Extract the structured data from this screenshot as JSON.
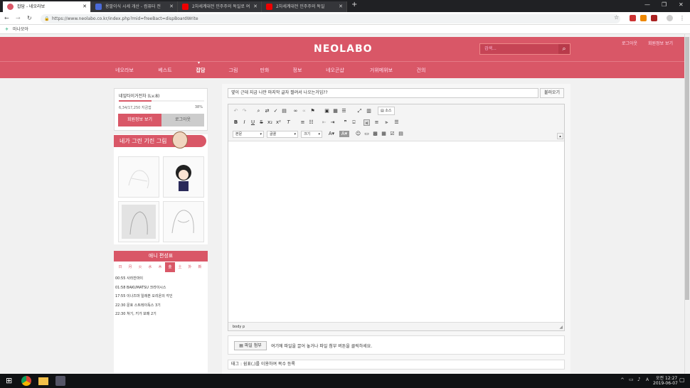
{
  "browser": {
    "tabs": [
      {
        "title": "잡담 - 네오라보"
      },
      {
        "title": "용팔이식 시세 개산 - 컴퓨터 전"
      },
      {
        "title": "2차세계대전 민주주의 독일로 여"
      },
      {
        "title": "2차세계대전 민주주의 독일"
      }
    ],
    "new_tab": "+",
    "url": "https://www.neolabo.co.kr/index.php?mid=freeBact=dispBoardWrite",
    "bookmark": "마나모아"
  },
  "site": {
    "logo": "NEOLABO",
    "search_placeholder": "검색...",
    "top_links": [
      "로그아웃",
      "회원정보 보기"
    ],
    "nav": [
      "네오라보",
      "베스트",
      "잡담",
      "그림",
      "만화",
      "정보",
      "네오곤샵",
      "거위메위보",
      "건의"
    ],
    "active_nav": "잡담"
  },
  "profile": {
    "name": "네잎타이거전차 (Lv.8)",
    "exp": "6,34/17,250 지금껍",
    "percent_text": "38%",
    "progress": 0.38,
    "btn_info": "회원정보 보기",
    "btn_logout": "로그아웃"
  },
  "gallery": {
    "title": "네가 그린 기린 그림"
  },
  "schedule": {
    "title": "애니 편성표",
    "days": [
      "日",
      "月",
      "火",
      "水",
      "木",
      "金",
      "土",
      "外",
      "新"
    ],
    "active_day": "金",
    "items": [
      {
        "time": "00:55",
        "name": "사라잔마이"
      },
      {
        "time": "01:58",
        "name": "BAKUMATSU 크라이시스"
      },
      {
        "time": "17:55",
        "name": "이나즈마 일레븐 오리온의 각인"
      },
      {
        "time": "22:30",
        "name": "문호 스트레이독스 3기"
      },
      {
        "time": "22:30",
        "name": "쳐기, 키가 보매 2기"
      }
    ]
  },
  "editor": {
    "title_value": "옆이 근데 지금 나만 마지막 글자 짤려서 나오는거임??",
    "load_btn": "불러오기",
    "source_btn": "소스",
    "format_select": "본문",
    "font_select": "글꼴",
    "size_select": "크기",
    "status_path": "body  p",
    "attach_btn": "파일 첨부",
    "attach_hint": "여기에 파일을 끌어 놓거나 파일 첨부 버튼을 클릭하세요.",
    "tag_placeholder": "태그 : 쉼표(,)를 이용하여 복수 등록"
  },
  "taskbar": {
    "time": "오전 12:27",
    "date": "2019-06-07",
    "ime": "A"
  },
  "colors": {
    "brand": "#d95767",
    "chrome_dark": "#202124"
  }
}
